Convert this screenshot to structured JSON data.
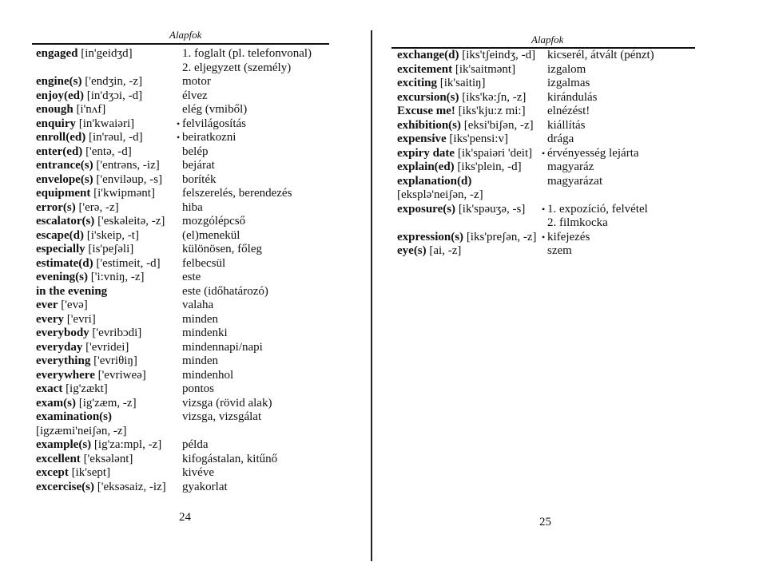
{
  "left_page": {
    "header": "Alapfok",
    "page_number": "24",
    "entries": [
      {
        "term": "engaged",
        "pron": " [in'geidʒd]",
        "def": "1. foglalt (pl. telefonvonal)"
      },
      {
        "term": "",
        "pron": "",
        "def": "2. eljegyzett (személy)"
      },
      {
        "term": "engine(s)",
        "pron": " ['endʒin, -z]",
        "def": "motor"
      },
      {
        "term": "enjoy(ed)",
        "pron": " [in'dʒɔi, -d]",
        "def": "élvez"
      },
      {
        "term": "enough",
        "pron": " [i'nʌf]",
        "def": "elég (vmiből)"
      },
      {
        "term": "enquiry",
        "pron": " [in'kwaiəri]",
        "def": "felvilágosítás",
        "bullet": true
      },
      {
        "term": "enroll(ed)",
        "pron": " [in'rəul, -d]",
        "def": "beiratkozni",
        "bullet": true
      },
      {
        "term": "enter(ed)",
        "pron": " ['entə, -d]",
        "def": "belép"
      },
      {
        "term": "entrance(s)",
        "pron": " ['entrəns, -iz]",
        "def": "bejárat"
      },
      {
        "term": "envelope(s)",
        "pron": " ['enviləup, -s]",
        "def": "boríték"
      },
      {
        "term": "equipment",
        "pron": " [i'kwipmənt]",
        "def": "felszerelés, berendezés"
      },
      {
        "term": "error(s)",
        "pron": " ['erə, -z]",
        "def": "hiba"
      },
      {
        "term": "escalator(s)",
        "pron": " ['eskəleitə, -z]",
        "def": "mozgólépcső"
      },
      {
        "term": "escape(d)",
        "pron": " [i'skeip, -t]",
        "def": "(el)menekül"
      },
      {
        "term": "especially",
        "pron": " [is'peʃəli]",
        "def": "különösen, főleg"
      },
      {
        "term": "estimate(d)",
        "pron": " ['estimeit, -d]",
        "def": "felbecsül"
      },
      {
        "term": "evening(s)",
        "pron": " ['i:vniŋ, -z]",
        "def": "este"
      },
      {
        "term": "in the evening",
        "pron": "",
        "def": "este (időhatározó)"
      },
      {
        "term": "ever",
        "pron": " ['evə]",
        "def": "valaha"
      },
      {
        "term": "every",
        "pron": " ['evri]",
        "def": "minden"
      },
      {
        "term": "everybody",
        "pron": " ['evribɔdi]",
        "def": "mindenki"
      },
      {
        "term": "everyday",
        "pron": " ['evridei]",
        "def": "mindennapi/napi"
      },
      {
        "term": "everything",
        "pron": " ['evriθiŋ]",
        "def": "minden"
      },
      {
        "term": "everywhere",
        "pron": " ['evriweə]",
        "def": "mindenhol"
      },
      {
        "term": "exact",
        "pron": " [ig'zækt]",
        "def": "pontos"
      },
      {
        "term": "exam(s)",
        "pron": " [ig'zæm, -z]",
        "def": "vizsga (rövid alak)"
      },
      {
        "term": "examination(s)",
        "pron": "",
        "def": "vizsga, vizsgálat"
      },
      {
        "term": "",
        "pron": "[igzæmi'neiʃən, -z]",
        "def": ""
      },
      {
        "term": "example(s)",
        "pron": " [ig'za:mpl, -z]",
        "def": "példa"
      },
      {
        "term": "excellent",
        "pron": " ['eksələnt]",
        "def": "kifogástalan, kitűnő"
      },
      {
        "term": "except",
        "pron": " [ik'sept]",
        "def": "kivéve"
      },
      {
        "term": "excercise(s)",
        "pron": " ['eksəsaiz, -iz]",
        "def": "gyakorlat"
      }
    ]
  },
  "right_page": {
    "header": "Alapfok",
    "page_number": "25",
    "entries": [
      {
        "term": "exchange(d)",
        "pron": " [iks'tʃeindʒ, -d]",
        "def": "kicserél, átvált (pénzt)"
      },
      {
        "term": "excitement",
        "pron": " [ik'saitmənt]",
        "def": "izgalom"
      },
      {
        "term": "exciting",
        "pron": " [ik'saitiŋ]",
        "def": "izgalmas"
      },
      {
        "term": "excursion(s)",
        "pron": " [iks'kə:ʃn, -z]",
        "def": "kirándulás"
      },
      {
        "term": "Excuse me!",
        "pron": " [iks'kju:z mi:]",
        "def": "elnézést!"
      },
      {
        "term": "exhibition(s)",
        "pron": " [eksi'biʃən, -z]",
        "def": "kiállítás"
      },
      {
        "term": "expensive",
        "pron": " [iks'pensi:v]",
        "def": "drága"
      },
      {
        "term": "expiry date",
        "pron": " [ik'spaiəri 'deit]",
        "def": "érvényesség lejárta",
        "bullet": true
      },
      {
        "term": "explain(ed)",
        "pron": " [iks'plein, -d]",
        "def": "magyaráz"
      },
      {
        "term": "explanation(d)",
        "pron": "",
        "def": "magyarázat"
      },
      {
        "term": "",
        "pron": "[eksplə'neiʃən, -z]",
        "def": ""
      },
      {
        "term": "exposure(s)",
        "pron": " [ik'spəuʒə, -s]",
        "def": "1. expozíció, felvétel",
        "bullet": true
      },
      {
        "term": "",
        "pron": "",
        "def": "2. filmkocka"
      },
      {
        "term": "expression(s)",
        "pron": " [iks'preʃən, -z]",
        "def": "kifejezés",
        "bullet": true
      },
      {
        "term": "eye(s)",
        "pron": " [ai, -z]",
        "def": "szem"
      }
    ]
  }
}
